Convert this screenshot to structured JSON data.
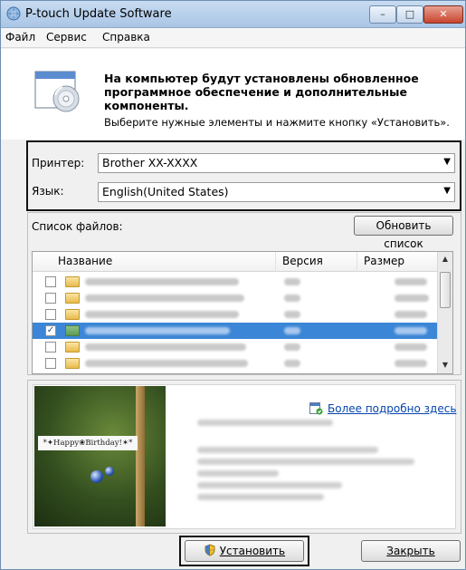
{
  "window": {
    "title": "P-touch Update Software",
    "minimize": "–",
    "maximize": "□",
    "close": "✕"
  },
  "menu": {
    "file": "Файл",
    "service": "Сервис",
    "help": "Справка"
  },
  "header": {
    "title": "На компьютер будут установлены обновленное программное обеспечение и дополнительные компоненты.",
    "subtitle": "Выберите нужные элементы и нажмите кнопку «Установить»."
  },
  "settings": {
    "printer_label": "Принтер:",
    "printer_value": "Brother XX-XXXX",
    "language_label": "Язык:",
    "language_value": "English(United States)"
  },
  "files": {
    "list_label": "Список файлов:",
    "refresh_button": "Обновить список",
    "columns": {
      "name": "Название",
      "version": "Версия",
      "size": "Размер"
    },
    "rows": [
      {
        "checked": false,
        "selected": false
      },
      {
        "checked": false,
        "selected": false
      },
      {
        "checked": false,
        "selected": false
      },
      {
        "checked": true,
        "selected": true
      },
      {
        "checked": false,
        "selected": false
      },
      {
        "checked": false,
        "selected": false
      }
    ],
    "check_mark": "✓"
  },
  "preview": {
    "more_link": "Более подробно здесь",
    "photo_label": "*✦Happy❀Birthday!✶*"
  },
  "buttons": {
    "install": "Установить",
    "close": "Закрыть"
  },
  "colors": {
    "selection": "#3b86d6",
    "link": "#0645ad"
  }
}
